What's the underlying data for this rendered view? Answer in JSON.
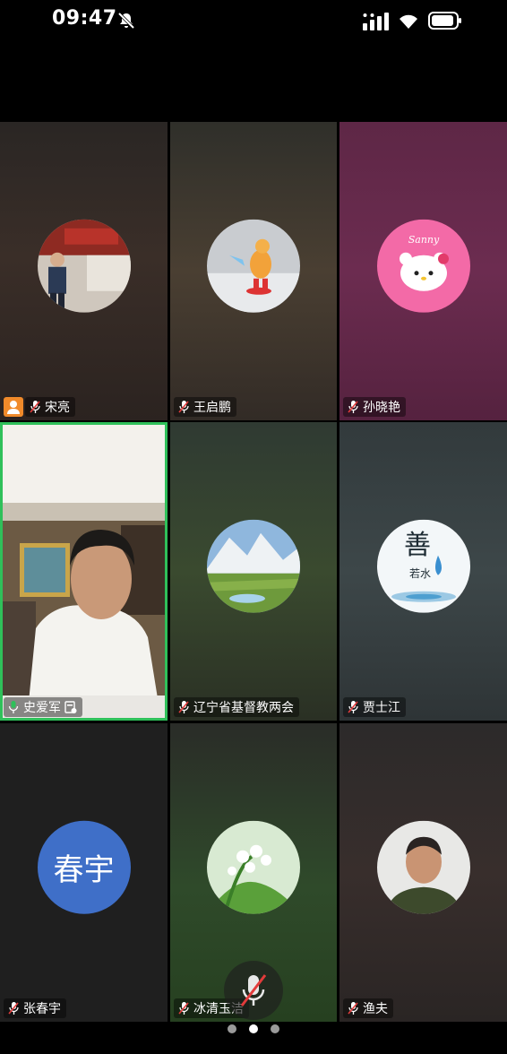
{
  "status_bar": {
    "time": "09:47"
  },
  "participants": [
    {
      "name": "宋亮",
      "host": true
    },
    {
      "name": "王启鹏"
    },
    {
      "name": "孙晓艳"
    },
    {
      "name": "史爱军",
      "active_speaker": true
    },
    {
      "name": "辽宁省基督教两会"
    },
    {
      "name": "贾士江"
    },
    {
      "name": "张春宇",
      "avatar_text": "春宇"
    },
    {
      "name": "冰清玉洁"
    },
    {
      "name": "渔夫"
    }
  ],
  "avatar_art": {
    "hello_kitty_text": "Sanny",
    "calligraphy_main": "善",
    "calligraphy_sub": "若水"
  },
  "pager": {
    "pages": 3,
    "current": 2
  },
  "colors": {
    "speaking_border": "#2fc05a",
    "host_badge": "#f08a2a",
    "avatar_blue": "#3f6fc8"
  }
}
